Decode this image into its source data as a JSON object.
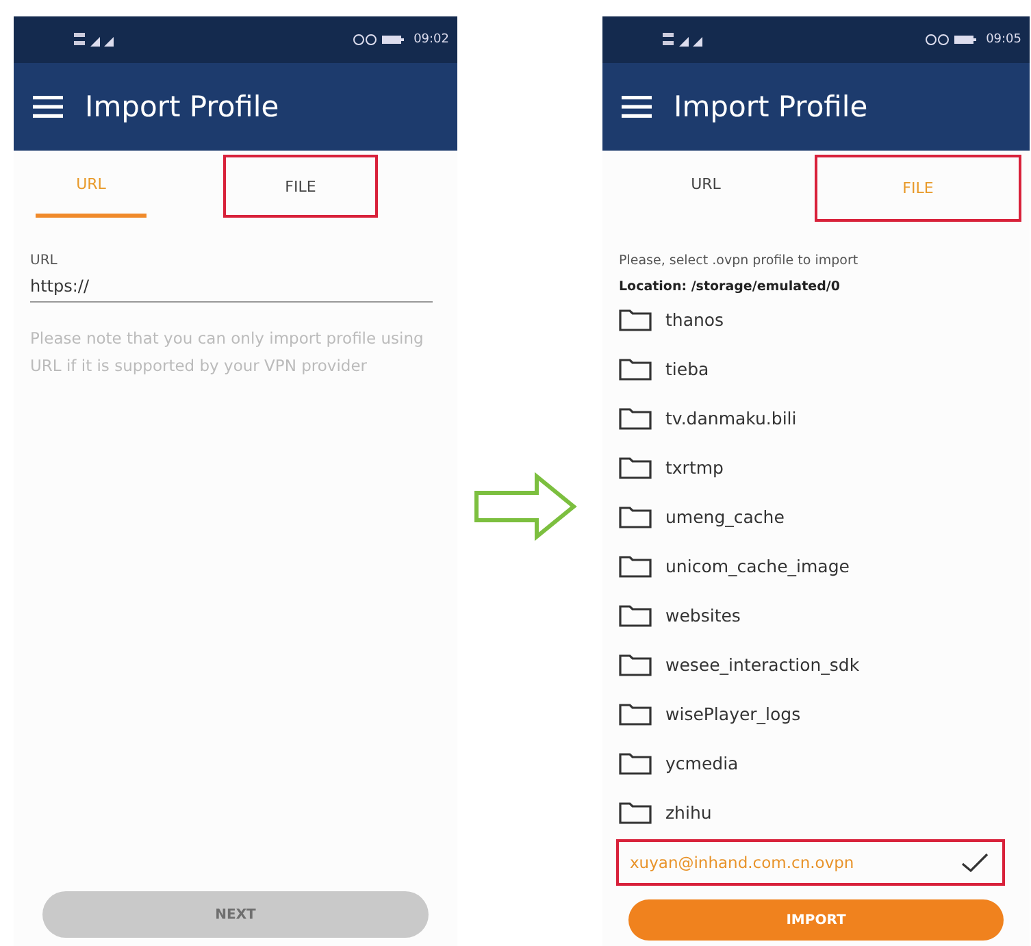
{
  "screens": [
    {
      "kind": "url",
      "status_bar": {
        "time": "09:02"
      },
      "title": "Import Profile",
      "tabs": [
        {
          "label": "URL",
          "selected": true,
          "highlighted": false
        },
        {
          "label": "FILE",
          "selected": false,
          "highlighted": true
        }
      ],
      "url_field": {
        "label": "URL",
        "value": "https://"
      },
      "note": "Please note that you can only import profile using URL if it is supported by your VPN provider",
      "button": {
        "label": "NEXT",
        "disabled": true
      }
    },
    {
      "kind": "file",
      "status_bar": {
        "time": "09:05"
      },
      "title": "Import Profile",
      "tabs": [
        {
          "label": "URL",
          "selected": false,
          "highlighted": false
        },
        {
          "label": "FILE",
          "selected": true,
          "highlighted": true
        }
      ],
      "instruction": "Please, select .ovpn profile to import",
      "location": "Location: /storage/emulated/0",
      "folders": [
        "thanos",
        "tieba",
        "tv.danmaku.bili",
        "txrtmp",
        "umeng_cache",
        "unicom_cache_image",
        "websites",
        "wesee_interaction_sdk",
        "wisePlayer_logs",
        "ycmedia",
        "zhihu"
      ],
      "files": [
        {
          "name": "xuyan@inhand.com.cn.ovpn",
          "selected": true,
          "highlighted": true
        }
      ],
      "button": {
        "label": "IMPORT",
        "disabled": false
      }
    }
  ]
}
